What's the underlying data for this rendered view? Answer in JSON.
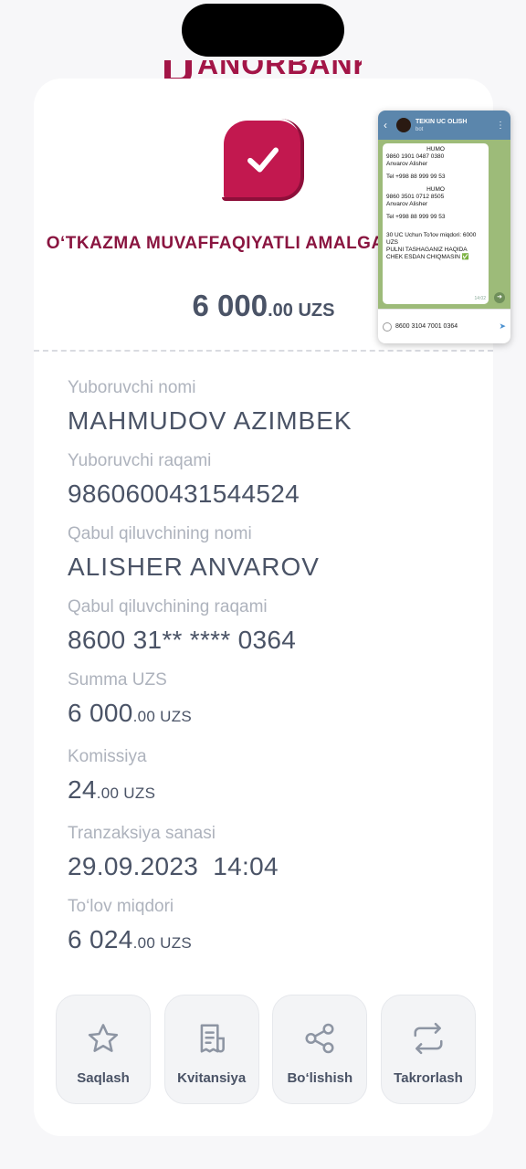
{
  "brand": {
    "name": "ANORBANK"
  },
  "receipt": {
    "status": "O‘TKAZMA MUVAFFAQIYATLI AMALGA OSHIRILDI",
    "amount_int": "6 000",
    "amount_dec": ".00 UZS",
    "fields": {
      "sender_name_label": "Yuboruvchi nomi",
      "sender_name": "MAHMUDOV AZIMBEK",
      "sender_number_label": "Yuboruvchi raqami",
      "sender_number": "9860600431544524",
      "receiver_name_label": "Qabul qiluvchining nomi",
      "receiver_name": "ALISHER ANVAROV",
      "receiver_number_label": "Qabul qiluvchining raqami",
      "receiver_number": "8600 31** **** 0364",
      "sum_label": "Summa UZS",
      "sum_int": "6 000",
      "sum_dec": ".00 UZS",
      "fee_label": "Komissiya",
      "fee_int": "24",
      "fee_dec": ".00 UZS",
      "date_label": "Tranzaksiya sanasi",
      "date": "29.09.2023  14:04",
      "total_label": "To‘lov miqdori",
      "total_int": "6 024",
      "total_dec": ".00 UZS"
    }
  },
  "actions": [
    {
      "label": "Saqlash",
      "icon": "star-icon"
    },
    {
      "label": "Kvitansiya",
      "icon": "receipt-icon"
    },
    {
      "label": "Bo‘lishish",
      "icon": "share-icon"
    },
    {
      "label": "Takrorlash",
      "icon": "repeat-icon"
    }
  ],
  "telegram": {
    "chat_name": "TEKIN UC OLISH",
    "chat_sub": "bot",
    "l1": "HUMO",
    "l2": "9860 1901 0487 0380",
    "l3": "Anvarov Alisher",
    "l4": "Tel   +998 88 999 99 53",
    "l5": "HUMO",
    "l6": "9860 3501 0712 8505",
    "l7": "Anvarov Alisher",
    "l8": "Tel   +998 88 999 99 53",
    "l9": "30 UC Uchun To'lov miqdori: 6000 UZS",
    "l10": "PULNI TASHAGANIZ HAQIDA CHEK ESDAN CHIQMASIN ✅",
    "time": "14:02",
    "input_text": "8600 3104 7001 0364"
  },
  "colors": {
    "accent": "#c2184f",
    "status_text": "#8a1540",
    "text": "#4a5366",
    "label": "#aeb3bd"
  }
}
